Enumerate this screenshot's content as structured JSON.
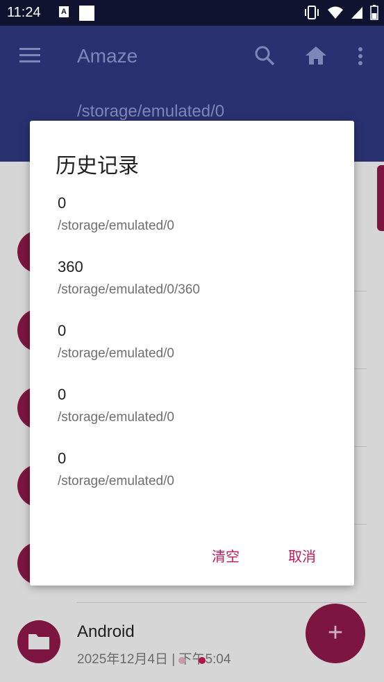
{
  "status_bar": {
    "time": "11:24",
    "icons": [
      "a-notification-icon",
      "white-square-icon",
      "vibrate-icon",
      "wifi-icon",
      "signal-icon",
      "battery-icon"
    ]
  },
  "app_bar": {
    "title": "Amaze",
    "path": "/storage/emulated/0",
    "icons": [
      "menu-icon",
      "search-icon",
      "home-icon",
      "more-vert-icon"
    ]
  },
  "background_list": {
    "visible_item": {
      "name": "Android",
      "date": "2025年12月4日 | 下午5:04"
    }
  },
  "dialog": {
    "title": "历史记录",
    "items": [
      {
        "name": "0",
        "path": "/storage/emulated/0"
      },
      {
        "name": "360",
        "path": "/storage/emulated/0/360"
      },
      {
        "name": "0",
        "path": "/storage/emulated/0"
      },
      {
        "name": "0",
        "path": "/storage/emulated/0"
      },
      {
        "name": "0",
        "path": "/storage/emulated/0"
      }
    ],
    "clear_label": "清空",
    "cancel_label": "取消"
  },
  "colors": {
    "accent": "#c2185b",
    "primary": "#2a3170",
    "status_bar": "#101330"
  },
  "fab_symbol": "+"
}
